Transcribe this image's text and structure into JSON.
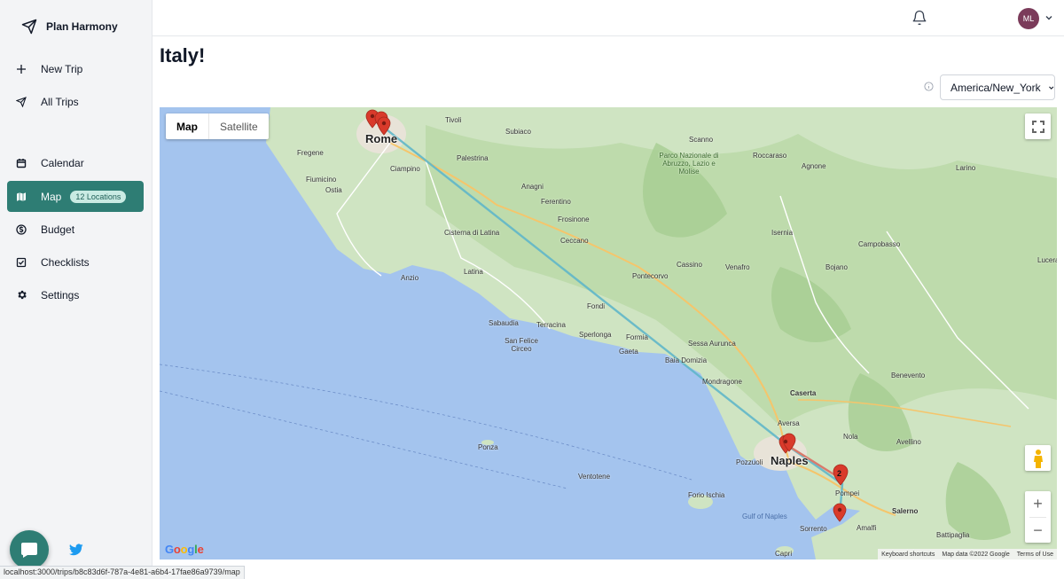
{
  "brand": {
    "name": "Plan Harmony",
    "icon": "paper-plane-icon"
  },
  "sidebar": {
    "items": [
      {
        "label": "New Trip",
        "icon": "plus-icon"
      },
      {
        "label": "All Trips",
        "icon": "paper-plane-icon"
      },
      {
        "label": "Calendar",
        "icon": "calendar-icon"
      },
      {
        "label": "Map",
        "icon": "map-icon",
        "badge": "12 Locations",
        "active": true
      },
      {
        "label": "Budget",
        "icon": "dollar-circle-icon"
      },
      {
        "label": "Checklists",
        "icon": "checklist-icon"
      },
      {
        "label": "Settings",
        "icon": "gear-icon"
      }
    ]
  },
  "header": {
    "avatar_initials": "ML"
  },
  "page": {
    "title": "Italy!"
  },
  "timezone": {
    "value": "America/New_York"
  },
  "map": {
    "type_controls": {
      "map": "Map",
      "satellite": "Satellite"
    },
    "cities": {
      "rome": "Rome",
      "naples": "Naples"
    },
    "places": {
      "tivoli": "Tivoli",
      "subiaco": "Subiaco",
      "palestrina": "Palestrina",
      "fregene": "Fregene",
      "fiumicino": "Fiumicino",
      "ostia": "Ostia",
      "ciampino": "Ciampino",
      "anagni": "Anagni",
      "ferentino": "Ferentino",
      "frosinone": "Frosinone",
      "cisterna": "Cisterna di Latina",
      "latina": "Latina",
      "anzio": "Anzio",
      "sabaudia": "Sabaudia",
      "terracina": "Terracina",
      "sanfelice": "San Felice Circeo",
      "sperlonga": "Sperlonga",
      "formia": "Formia",
      "gaeta": "Gaeta",
      "fondi": "Fondi",
      "ceccano": "Ceccano",
      "pontecorvo": "Pontecorvo",
      "cassino": "Cassino",
      "scanno": "Scanno",
      "parco": "Parco Nazionale di Abruzzo, Lazio e Molise",
      "isernia": "Isernia",
      "venafro": "Venafro",
      "caserta": "Caserta",
      "aversa": "Aversa",
      "pozzuoli": "Pozzuoli",
      "pompei": "Pompei",
      "sorrento": "Sorrento",
      "amalfi": "Amalfi",
      "salerno": "Salerno",
      "capri": "Capri",
      "ponza": "Ponza",
      "ventotene": "Ventotene",
      "ischia": "Forio Ischia",
      "campobasso": "Campobasso",
      "benevento": "Benevento",
      "avellino": "Avellino",
      "battipaglia": "Battipaglia",
      "bojano": "Bojano",
      "larino": "Larino",
      "lucera": "Lucera",
      "mondragone": "Mondragone",
      "baia": "Baia Domizia",
      "sessa": "Sessa Aurunca",
      "nola": "Nola",
      "roccaraso": "Roccaraso",
      "agnone": "Agnone"
    },
    "water_labels": {
      "gulf": "Gulf of Naples"
    },
    "cluster_count": "2",
    "google": "Google",
    "attribution": {
      "shortcuts": "Keyboard shortcuts",
      "data": "Map data ©2022 Google",
      "terms": "Terms of Use"
    }
  },
  "statusbar": {
    "url": "localhost:3000/trips/b8c83d6f-787a-4e81-a6b4-17fae86a9739/map"
  },
  "colors": {
    "accent": "#2e7d74",
    "route": "#5fb6c9",
    "marker": "#d93a2b"
  }
}
